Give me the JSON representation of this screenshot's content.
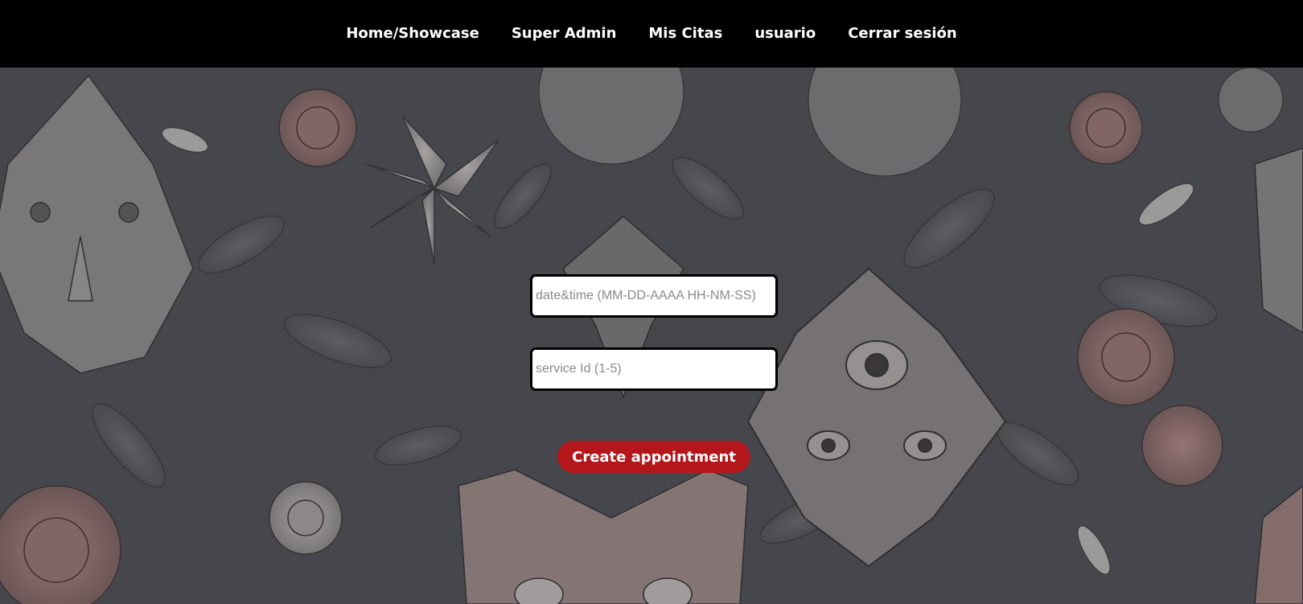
{
  "navbar": {
    "links": [
      {
        "label": "Home/Showcase"
      },
      {
        "label": "Super Admin"
      },
      {
        "label": "Mis Citas"
      },
      {
        "label": "usuario"
      },
      {
        "label": "Cerrar sesión"
      }
    ]
  },
  "form": {
    "datetime_placeholder": "date&time (MM-DD-AAAA HH-NM-SS)",
    "datetime_value": "",
    "service_placeholder": "service Id (1-5)",
    "service_value": "",
    "submit_label": "Create appointment"
  },
  "colors": {
    "navbar_bg": "#000000",
    "button_bg": "#b3171b",
    "background": "#4a4b50"
  }
}
